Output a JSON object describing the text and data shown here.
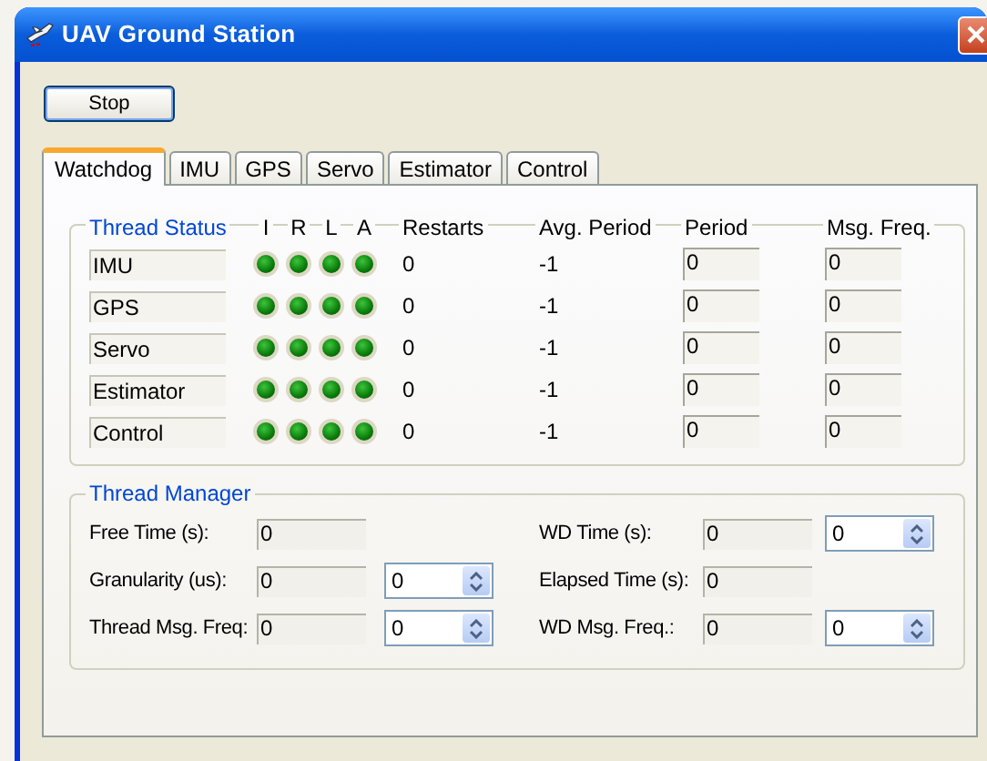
{
  "window": {
    "title": "UAV Ground Station"
  },
  "stop_button": {
    "label": "Stop"
  },
  "tabs": [
    {
      "label": "Watchdog",
      "selected": true
    },
    {
      "label": "IMU",
      "selected": false
    },
    {
      "label": "GPS",
      "selected": false
    },
    {
      "label": "Servo",
      "selected": false
    },
    {
      "label": "Estimator",
      "selected": false
    },
    {
      "label": "Control",
      "selected": false
    }
  ],
  "thread_status": {
    "title": "Thread Status",
    "columns": [
      "I",
      "R",
      "L",
      "A",
      "Restarts",
      "Avg. Period",
      "Period",
      "Msg. Freq."
    ],
    "rows": [
      {
        "name": "IMU",
        "indicators": [
          {
            "on": true
          },
          {
            "on": true
          },
          {
            "on": true
          },
          {
            "on": true
          }
        ],
        "restarts": "0",
        "avg_period": "-1",
        "period": "0",
        "msg_freq": "0"
      },
      {
        "name": "GPS",
        "indicators": [
          {
            "on": true
          },
          {
            "on": true
          },
          {
            "on": true
          },
          {
            "on": true
          }
        ],
        "restarts": "0",
        "avg_period": "-1",
        "period": "0",
        "msg_freq": "0"
      },
      {
        "name": "Servo",
        "indicators": [
          {
            "on": true
          },
          {
            "on": true
          },
          {
            "on": true
          },
          {
            "on": true
          }
        ],
        "restarts": "0",
        "avg_period": "-1",
        "period": "0",
        "msg_freq": "0"
      },
      {
        "name": "Estimator",
        "indicators": [
          {
            "on": true
          },
          {
            "on": true
          },
          {
            "on": true
          },
          {
            "on": true
          }
        ],
        "restarts": "0",
        "avg_period": "-1",
        "period": "0",
        "msg_freq": "0"
      },
      {
        "name": "Control",
        "indicators": [
          {
            "on": true
          },
          {
            "on": true
          },
          {
            "on": true
          },
          {
            "on": true
          }
        ],
        "restarts": "0",
        "avg_period": "-1",
        "period": "0",
        "msg_freq": "0"
      }
    ]
  },
  "thread_manager": {
    "title": "Thread Manager",
    "fields": [
      {
        "label": "Free Time (s):",
        "value": "0"
      },
      {
        "label": "WD Time (s):",
        "value": "0",
        "spinner": "0"
      },
      {
        "label": "Granularity (us):",
        "value": "0",
        "spinner": "0"
      },
      {
        "label": "Elapsed Time (s):",
        "value": "0"
      },
      {
        "label": "Thread Msg. Freq:",
        "value": "0",
        "spinner": "0"
      },
      {
        "label": "WD Msg. Freq.:",
        "value": "0",
        "spinner": "0"
      }
    ]
  }
}
